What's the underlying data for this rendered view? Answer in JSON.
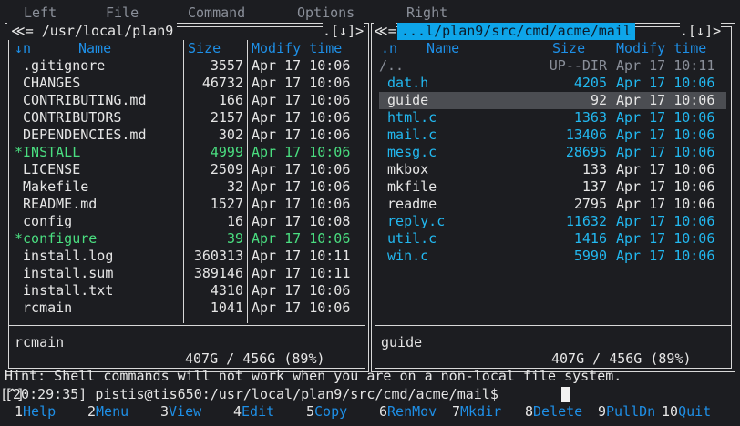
{
  "menu": {
    "left": "Left",
    "file": "File",
    "command": "Command",
    "options": "Options",
    "right": "Right"
  },
  "left_panel": {
    "path": " ≪= /usr/local/plan9 ",
    "corner": ".[↓]>",
    "headers": {
      "sort": "↓n",
      "name": "Name",
      "size": "Size",
      "modify": "Modify time"
    },
    "files": [
      {
        "name": " .gitignore",
        "size": "3557",
        "time": "Apr 17 10:06",
        "kind": "normal"
      },
      {
        "name": " CHANGES",
        "size": "46732",
        "time": "Apr 17 10:06",
        "kind": "normal"
      },
      {
        "name": " CONTRIBUTING.md",
        "size": "166",
        "time": "Apr 17 10:06",
        "kind": "normal"
      },
      {
        "name": " CONTRIBUTORS",
        "size": "2157",
        "time": "Apr 17 10:06",
        "kind": "normal"
      },
      {
        "name": " DEPENDENCIES.md",
        "size": "302",
        "time": "Apr 17 10:06",
        "kind": "normal"
      },
      {
        "name": "*INSTALL",
        "size": "4999",
        "time": "Apr 17 10:06",
        "kind": "exec"
      },
      {
        "name": " LICENSE",
        "size": "2509",
        "time": "Apr 17 10:06",
        "kind": "normal"
      },
      {
        "name": " Makefile",
        "size": "32",
        "time": "Apr 17 10:06",
        "kind": "normal"
      },
      {
        "name": " README.md",
        "size": "1527",
        "time": "Apr 17 10:06",
        "kind": "normal"
      },
      {
        "name": " config",
        "size": "16",
        "time": "Apr 17 10:08",
        "kind": "normal"
      },
      {
        "name": "*configure",
        "size": "39",
        "time": "Apr 17 10:06",
        "kind": "exec"
      },
      {
        "name": " install.log",
        "size": "360313",
        "time": "Apr 17 10:11",
        "kind": "normal"
      },
      {
        "name": " install.sum",
        "size": "389146",
        "time": "Apr 17 10:11",
        "kind": "normal"
      },
      {
        "name": " install.txt",
        "size": "4310",
        "time": "Apr 17 10:06",
        "kind": "normal"
      },
      {
        "name": " rcmain",
        "size": "1041",
        "time": "Apr 17 10:06",
        "kind": "normal"
      }
    ],
    "status": " rcmain",
    "disk": " 407G / 456G (89%) "
  },
  "right_panel": {
    "path": " ...l/plan9/src/cmd/acme/mail ",
    "corner_left": "≪=",
    "corner": ".[↓]>",
    "headers": {
      "sort": ".n",
      "name": "Name",
      "size": "Size",
      "modify": "Modify time"
    },
    "files": [
      {
        "name": "/..",
        "size": "UP--DIR",
        "time": "Apr 17 10:11",
        "kind": "dim"
      },
      {
        "name": " dat.h",
        "size": "4205",
        "time": "Apr 17 10:06",
        "kind": "file"
      },
      {
        "name": " guide",
        "size": "92",
        "time": "Apr 17 10:06",
        "kind": "selected"
      },
      {
        "name": " html.c",
        "size": "1363",
        "time": "Apr 17 10:06",
        "kind": "file"
      },
      {
        "name": " mail.c",
        "size": "13406",
        "time": "Apr 17 10:06",
        "kind": "file"
      },
      {
        "name": " mesg.c",
        "size": "28695",
        "time": "Apr 17 10:06",
        "kind": "file"
      },
      {
        "name": " mkbox",
        "size": "133",
        "time": "Apr 17 10:06",
        "kind": "normal"
      },
      {
        "name": " mkfile",
        "size": "137",
        "time": "Apr 17 10:06",
        "kind": "normal"
      },
      {
        "name": " readme",
        "size": "2795",
        "time": "Apr 17 10:06",
        "kind": "normal"
      },
      {
        "name": " reply.c",
        "size": "11632",
        "time": "Apr 17 10:06",
        "kind": "file"
      },
      {
        "name": " util.c",
        "size": "1416",
        "time": "Apr 17 10:06",
        "kind": "file"
      },
      {
        "name": " win.c",
        "size": "5990",
        "time": "Apr 17 10:06",
        "kind": "file"
      }
    ],
    "status": " guide",
    "disk": " 407G / 456G (89%) "
  },
  "hint": "Hint: Shell commands will not work when you are on a non-local file system.",
  "prompt": "[20:29:35] pistis@tis650:/usr/local/plan9/src/cmd/acme/mail$",
  "caret": "[^]",
  "keys": [
    {
      "num": "1",
      "label": "Help"
    },
    {
      "num": "2",
      "label": "Menu"
    },
    {
      "num": "3",
      "label": "View"
    },
    {
      "num": "4",
      "label": "Edit"
    },
    {
      "num": "5",
      "label": "Copy"
    },
    {
      "num": "6",
      "label": "RenMov"
    },
    {
      "num": "7",
      "label": "Mkdir"
    },
    {
      "num": "8",
      "label": "Delete"
    },
    {
      "num": "9",
      "label": "PullDn"
    },
    {
      "num": "10",
      "label": "Quit"
    }
  ]
}
